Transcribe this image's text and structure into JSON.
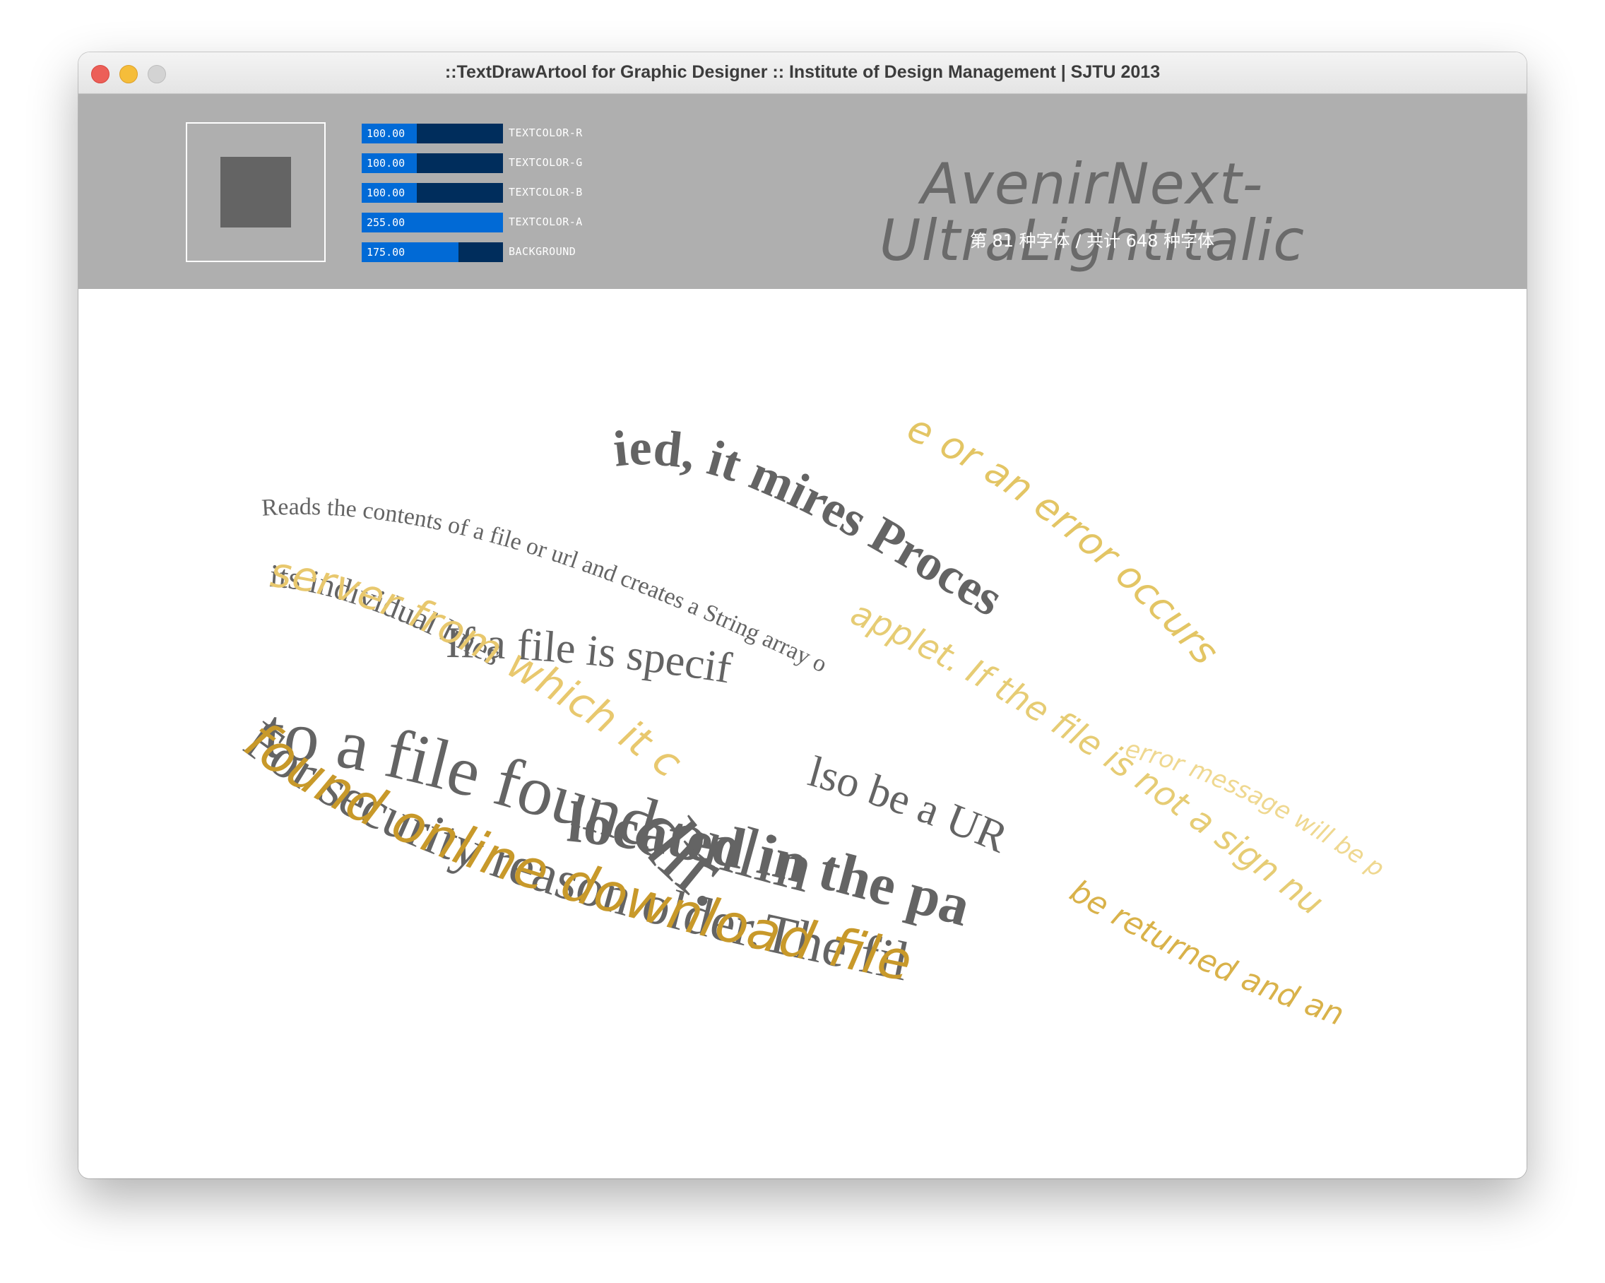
{
  "window": {
    "title": "::TextDrawArtool for Graphic Designer :: Institute of Design Management | SJTU 2013"
  },
  "controls": {
    "sliders": [
      {
        "value": "100.00",
        "label": "TEXTCOLOR-R",
        "fraction": 0.392
      },
      {
        "value": "100.00",
        "label": "TEXTCOLOR-G",
        "fraction": 0.392
      },
      {
        "value": "100.00",
        "label": "TEXTCOLOR-B",
        "fraction": 0.392
      },
      {
        "value": "255.00",
        "label": "TEXTCOLOR-A",
        "fraction": 1.0
      },
      {
        "value": "175.00",
        "label": "BACKGROUND",
        "fraction": 0.686
      }
    ],
    "font_name": "AvenirNext-UltraLightItalic",
    "font_count": "第 81 种字体 / 共计 648 种字体"
  },
  "colors": {
    "text_gray": "#646464",
    "gold": "#c89a2a",
    "panel": "#afafaf",
    "slider_fill": "#016ad6",
    "slider_track": "#002d5c"
  }
}
